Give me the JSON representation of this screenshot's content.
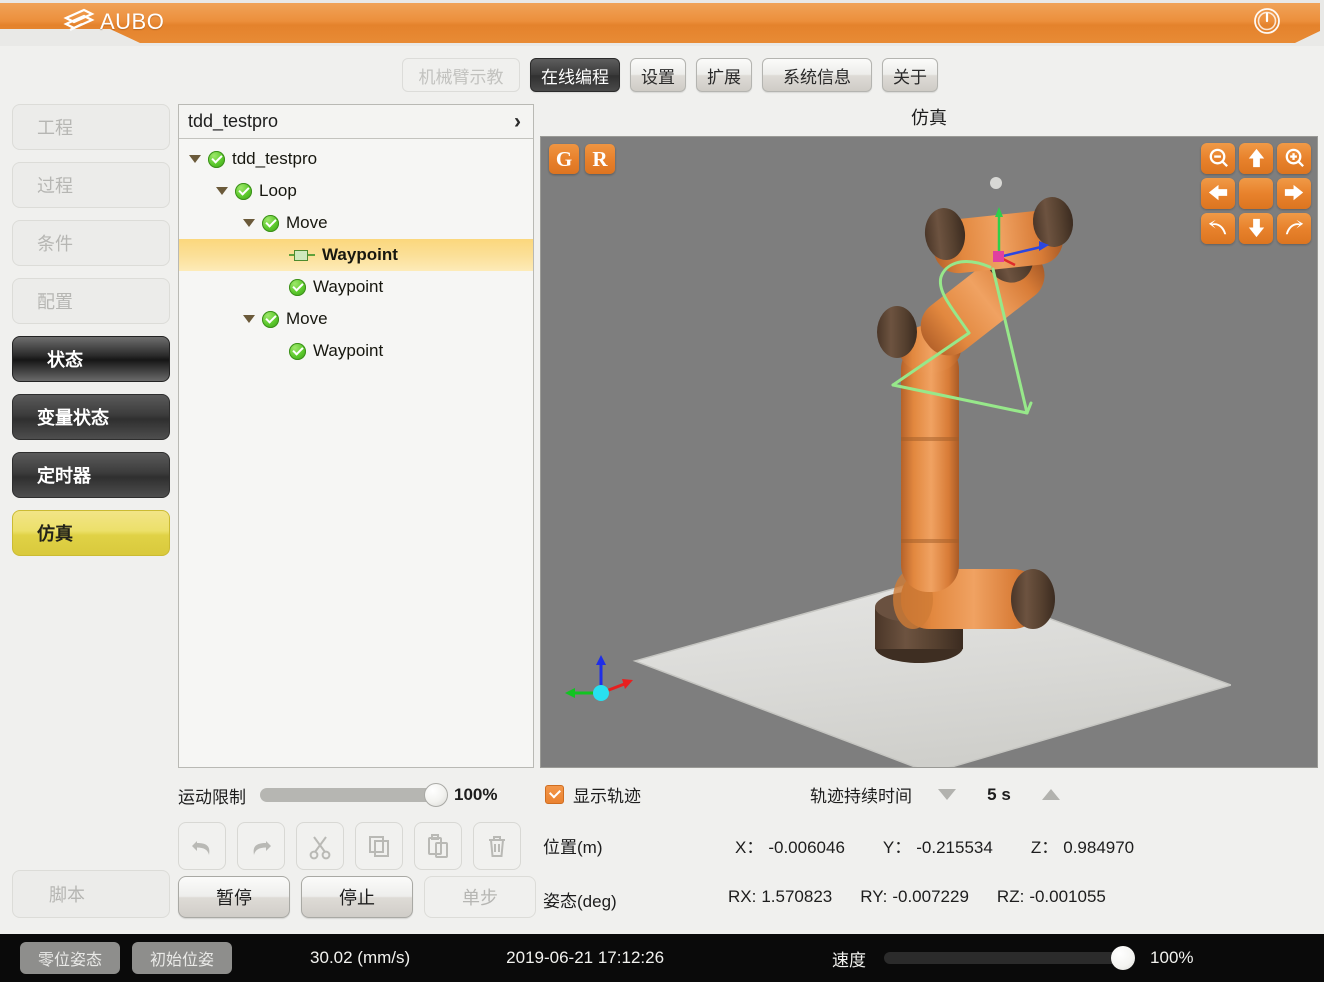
{
  "app": {
    "brand": "AUBO",
    "power_icon": "power-icon"
  },
  "nav": {
    "tabs": [
      {
        "label": "机械臂示教",
        "state": "disabled"
      },
      {
        "label": "在线编程",
        "state": "active"
      },
      {
        "label": "设置",
        "state": "normal"
      },
      {
        "label": "扩展",
        "state": "normal"
      },
      {
        "label": "系统信息",
        "state": "normal"
      },
      {
        "label": "关于",
        "state": "normal"
      }
    ]
  },
  "sidebar": {
    "items": [
      {
        "label": "工程",
        "style": "disabled"
      },
      {
        "label": "过程",
        "style": "disabled"
      },
      {
        "label": "条件",
        "style": "disabled"
      },
      {
        "label": "配置",
        "style": "disabled"
      },
      {
        "label": "状态",
        "style": "dark-sel"
      },
      {
        "label": "变量状态",
        "style": "dark"
      },
      {
        "label": "定时器",
        "style": "dark"
      },
      {
        "label": "仿真",
        "style": "yellow"
      }
    ],
    "script_button": "脚本"
  },
  "tree": {
    "header_title": "tdd_testpro",
    "header_arrow": "›",
    "nodes": [
      {
        "label": "tdd_testpro",
        "depth": 0,
        "icon": "green-check",
        "expandable": true,
        "selected": false
      },
      {
        "label": "Loop",
        "depth": 1,
        "icon": "green-check",
        "expandable": true,
        "selected": false
      },
      {
        "label": "Move",
        "depth": 2,
        "icon": "green-check",
        "expandable": true,
        "selected": false
      },
      {
        "label": "Waypoint",
        "depth": 3,
        "icon": "waypoint-stub",
        "expandable": false,
        "selected": true
      },
      {
        "label": "Waypoint",
        "depth": 3,
        "icon": "green-check",
        "expandable": false,
        "selected": false
      },
      {
        "label": "Move",
        "depth": 2,
        "icon": "green-check",
        "expandable": true,
        "selected": false
      },
      {
        "label": "Waypoint",
        "depth": 3,
        "icon": "green-check",
        "expandable": false,
        "selected": false
      }
    ]
  },
  "simulation": {
    "title": "仿真",
    "overlay_buttons": [
      {
        "label": "G",
        "name": "grid-toggle-button"
      },
      {
        "label": "R",
        "name": "reset-view-button"
      }
    ],
    "nav_pad": [
      "zoom-out-icon",
      "arrow-up-icon",
      "zoom-in-icon",
      "arrow-left-icon",
      "home-view-icon",
      "arrow-right-icon",
      "rotate-left-icon",
      "arrow-down-icon",
      "rotate-right-icon"
    ]
  },
  "controls": {
    "motion_limit_label": "运动限制",
    "motion_limit_percent": "100%",
    "motion_limit_value": 100,
    "show_trajectory_label": "显示轨迹",
    "show_trajectory_checked": true,
    "trajectory_duration_label": "轨迹持续时间",
    "trajectory_duration_value": "5 s",
    "toolbar": [
      {
        "name": "undo-icon",
        "label": "撤销",
        "disabled": true
      },
      {
        "name": "redo-icon",
        "label": "重做",
        "disabled": true
      },
      {
        "name": "cut-icon",
        "label": "剪切",
        "disabled": true
      },
      {
        "name": "copy-icon",
        "label": "复制",
        "disabled": true
      },
      {
        "name": "paste-icon",
        "label": "粘贴",
        "disabled": true
      },
      {
        "name": "trash-icon",
        "label": "删除",
        "disabled": true
      }
    ],
    "run_buttons": [
      {
        "label": "暂停",
        "state": "normal"
      },
      {
        "label": "停止",
        "state": "normal"
      },
      {
        "label": "单步",
        "state": "disabled"
      }
    ]
  },
  "readout": {
    "position_label": "位置(m)",
    "orientation_label": "姿态(deg)",
    "position": [
      {
        "axis": "X：",
        "value": "-0.006046"
      },
      {
        "axis": "Y：",
        "value": "-0.215534"
      },
      {
        "axis": "Z：",
        "value": "0.984970"
      }
    ],
    "orientation": [
      {
        "axis": "RX:",
        "value": "1.570823"
      },
      {
        "axis": "RY:",
        "value": "-0.007229"
      },
      {
        "axis": "RZ:",
        "value": "-0.001055"
      }
    ]
  },
  "statusbar": {
    "zero_pose_button": "零位姿态",
    "init_pose_button": "初始位姿",
    "speed_readout": "30.02 (mm/s)",
    "timestamp": "2019-06-21 17:12:26",
    "speed_label": "速度",
    "speed_percent": "100%",
    "speed_value": 100
  },
  "colors": {
    "brand_orange": "#e8822c",
    "accent_yellow": "#e0d246",
    "selection_amber": "#fbd77c",
    "viewport_gray": "#7e7e7e",
    "trajectory_green": "#97e88a"
  }
}
